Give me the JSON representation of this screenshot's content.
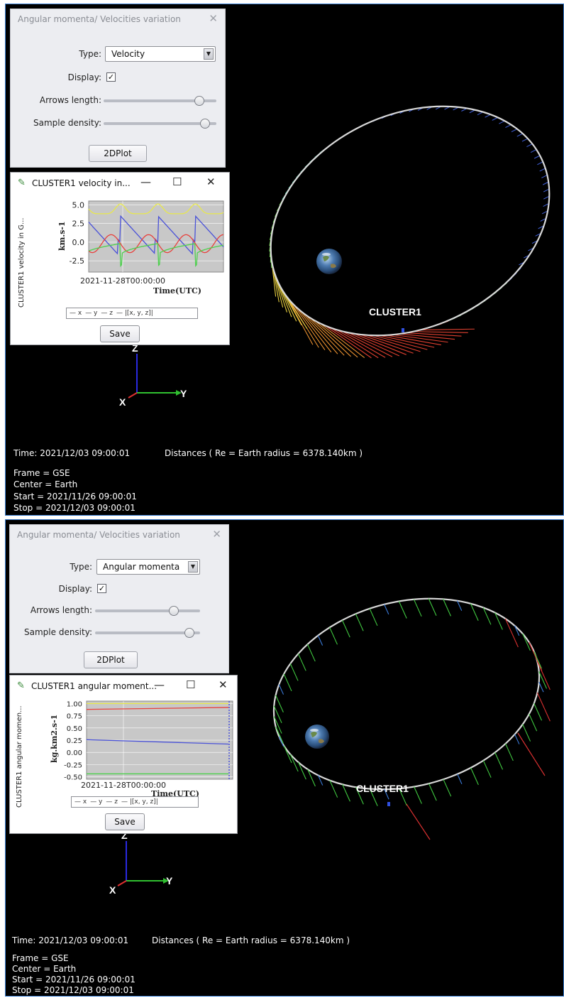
{
  "panels": [
    {
      "control": {
        "title": "Angular momenta/ Velocities variation",
        "close_glyph": "✕",
        "type_label": "Type:",
        "type_value": "Velocity",
        "display_label": "Display:",
        "display_checked": true,
        "arrows_label": "Arrows length:",
        "arrows_value": 0.85,
        "density_label": "Sample density:",
        "density_value": 0.9,
        "plot_button": "2DPlot"
      },
      "plot_window": {
        "title": "CLUSTER1 velocity in...",
        "min_glyph": "—",
        "max_glyph": "☐",
        "close_glyph": "✕",
        "side_label": "CLUSTER1 velocity in G...",
        "ylabel": "km.s-1",
        "xtick": "2021-11-28T00:00:00",
        "xlabel": "Time(UTC)",
        "yticks": [
          "5.0",
          "2.5",
          "0.0",
          "-2.5"
        ],
        "legend": [
          "x",
          "y",
          "z",
          "|[x, y, z]|"
        ],
        "save": "Save"
      },
      "spacecraft": "CLUSTER1",
      "axes": {
        "z": "Z",
        "x": "X",
        "y": "Y"
      },
      "info": {
        "time": "Time: 2021/12/03 09:00:01",
        "distances": "Distances ( Re = Earth radius = 6378.140km )",
        "frame": "Frame = GSE",
        "center": "Center = Earth",
        "start": "Start = 2021/11/26 09:00:01",
        "stop": "Stop = 2021/12/03 09:00:01"
      }
    },
    {
      "control": {
        "title": "Angular momenta/ Velocities variation",
        "close_glyph": "✕",
        "type_label": "Type:",
        "type_value": "Angular momenta",
        "display_label": "Display:",
        "display_checked": true,
        "arrows_label": "Arrows length:",
        "arrows_value": 0.75,
        "density_label": "Sample density:",
        "density_value": 0.9,
        "plot_button": "2DPlot"
      },
      "plot_window": {
        "title": "CLUSTER1 angular moment...",
        "min_glyph": "—",
        "max_glyph": "☐",
        "close_glyph": "✕",
        "side_label": "CLUSTER1 angular momen...",
        "ylabel": "kg.km2.s-1",
        "xtick": "2021-11-28T00:00:00",
        "xlabel": "Time(UTC)",
        "yticks": [
          "1.00",
          "0.75",
          "0.50",
          "0.25",
          "0.00",
          "-0.25",
          "-0.50"
        ],
        "legend": [
          "x",
          "y",
          "z",
          "|[x, y, z]|"
        ],
        "save": "Save"
      },
      "spacecraft": "CLUSTER1",
      "axes": {
        "z": "Z",
        "x": "X",
        "y": "Y"
      },
      "info": {
        "time": "Time: 2021/12/03 09:00:01",
        "distances": "Distances ( Re = Earth radius = 6378.140km )",
        "frame": "Frame = GSE",
        "center": "Center = Earth",
        "start": "Start = 2021/11/26 09:00:01",
        "stop": "Stop = 2021/12/03 09:00:01"
      }
    }
  ],
  "colors": {
    "x": "#e8413c",
    "y": "#4a52d8",
    "z": "#4cd04c",
    "mag": "#e8e84c",
    "frame_border": "#3b7fd1"
  }
}
